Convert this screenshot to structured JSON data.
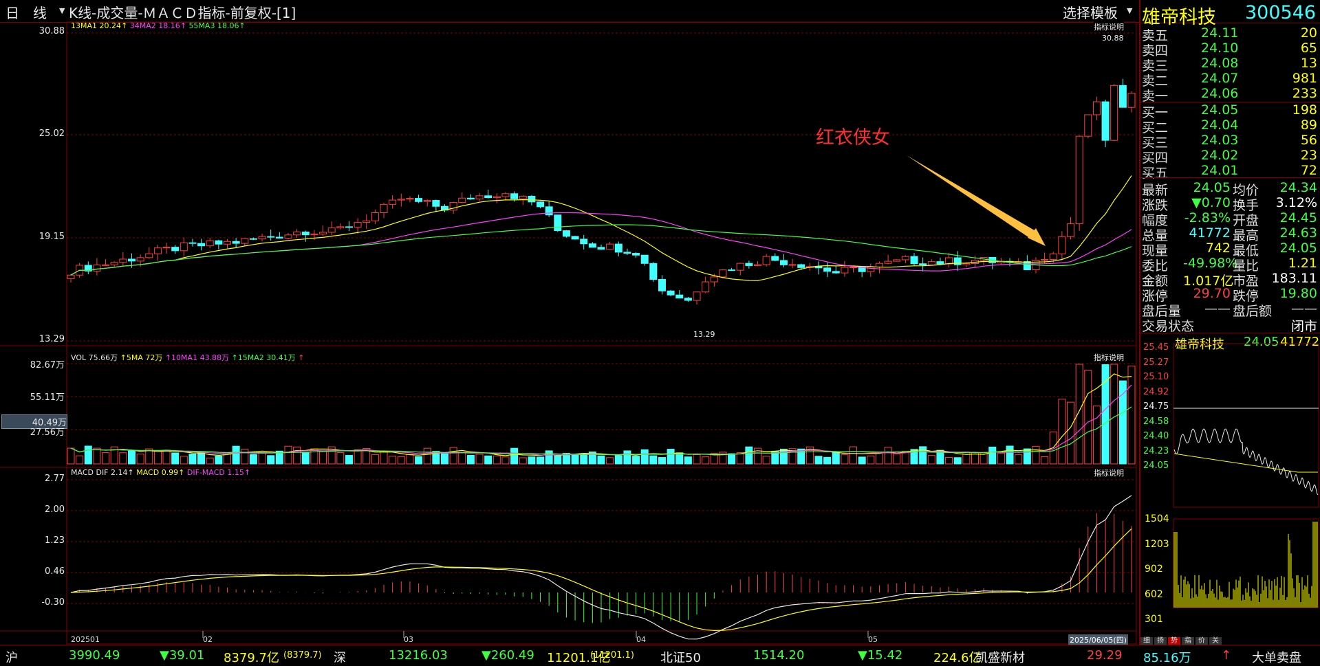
{
  "header": {
    "period": "日　线",
    "title": "K线-成交量-ＭＡＣＤ指标-前复权-[1]",
    "template_btn": "选择模板"
  },
  "stock": {
    "name": "雄帝科技",
    "code": "300546"
  },
  "kline": {
    "ma_legend": [
      {
        "text": "13MA1 20.24↑",
        "color": "#ffff00"
      },
      {
        "text": "34MA2 18.16↑",
        "color": "#ff40ff"
      },
      {
        "text": "55MA3 18.06↑",
        "color": "#40ff40"
      }
    ],
    "ylabels": [
      "30.88",
      "25.02",
      "19.15",
      "13.29"
    ],
    "indicator_btn": "指标说明",
    "high_note": "30.88",
    "low_note": "13.29",
    "annotation": "红衣侠女",
    "up_color": "#ff4040",
    "down_color": "#40ffff"
  },
  "volume": {
    "legend": [
      {
        "text": "VOL 75.66万",
        "color": "#e8e8e8"
      },
      {
        "text": "↑5MA 72万",
        "color": "#ffff00"
      },
      {
        "text": "↑10MA1 43.88万",
        "color": "#ff40ff"
      },
      {
        "text": "↑15MA2 30.41万",
        "color": "#40ff40"
      },
      {
        "text": "↑",
        "color": "#ff4040"
      }
    ],
    "ylabels": [
      "82.67万",
      "55.11万",
      "40.49万",
      "27.56万"
    ],
    "indicator_btn": "指标说明"
  },
  "macd": {
    "legend": [
      {
        "text": "MACD DIF 2.14↑",
        "color": "#e8e8e8"
      },
      {
        "text": "MACD 0.99↑",
        "color": "#ffff00"
      },
      {
        "text": "DIF-MACD 1.15↑",
        "color": "#ff40ff"
      }
    ],
    "ylabels": [
      "2.77",
      "2.00",
      "1.23",
      "0.46",
      "-0.30"
    ],
    "indicator_btn": "指标说明"
  },
  "xaxis": {
    "labels": [
      "202501",
      "02",
      "03",
      "04",
      "05"
    ],
    "current_date": "2025/06/05(四)"
  },
  "orderbook": [
    {
      "label": "卖五",
      "price": "24.11",
      "vol": "20"
    },
    {
      "label": "卖四",
      "price": "24.10",
      "vol": "65"
    },
    {
      "label": "卖三",
      "price": "24.08",
      "vol": "13"
    },
    {
      "label": "卖二",
      "price": "24.07",
      "vol": "981"
    },
    {
      "label": "卖一",
      "price": "24.06",
      "vol": "233"
    },
    {
      "label": "买一",
      "price": "24.05",
      "vol": "198"
    },
    {
      "label": "买二",
      "price": "24.04",
      "vol": "89"
    },
    {
      "label": "买三",
      "price": "24.03",
      "vol": "56"
    },
    {
      "label": "买四",
      "price": "24.02",
      "vol": "23"
    },
    {
      "label": "买五",
      "price": "24.01",
      "vol": "72"
    }
  ],
  "quote": [
    {
      "l1": "最新",
      "v1": "24.05",
      "c1": "#40ff40",
      "l2": "均价",
      "v2": "24.34",
      "c2": "#40ff40"
    },
    {
      "l1": "涨跌",
      "v1": "▼0.70",
      "c1": "#40ff40",
      "l2": "换手",
      "v2": "3.12%",
      "c2": "#ffffff"
    },
    {
      "l1": "幅度",
      "v1": "-2.83%",
      "c1": "#40ff40",
      "l2": "开盘",
      "v2": "24.45",
      "c2": "#40ff40"
    },
    {
      "l1": "总量",
      "v1": "41772",
      "c1": "#40ffff",
      "l2": "最高",
      "v2": "24.63",
      "c2": "#40ff40"
    },
    {
      "l1": "现量",
      "v1": "742",
      "c1": "#ffff00",
      "l2": "最低",
      "v2": "24.05",
      "c2": "#40ff40"
    },
    {
      "l1": "委比",
      "v1": "-49.98%",
      "c1": "#40ff40",
      "l2": "量比",
      "v2": "1.21",
      "c2": "#ffff00"
    },
    {
      "l1": "金额",
      "v1": "1.017亿",
      "c1": "#ffff00",
      "l2": "市盈",
      "v2": "183.11",
      "c2": "#ffffff"
    },
    {
      "l1": "涨停",
      "v1": "29.70",
      "c1": "#ff4040",
      "l2": "跌停",
      "v2": "19.80",
      "c2": "#40ff40"
    },
    {
      "l1": "盘后量",
      "v1": "——",
      "c1": "#c8c8c8",
      "l2": "盘后额",
      "v2": "——",
      "c2": "#c8c8c8"
    },
    {
      "l1": "交易状态",
      "v1": "",
      "c1": "#c8c8c8",
      "l2": "",
      "v2": "闭市",
      "c2": "#ffffff"
    }
  ],
  "minichart": {
    "name": "雄帝科技",
    "price": "24.05",
    "volume": "41772",
    "price_labels": [
      "25.45",
      "25.27",
      "25.10",
      "24.92",
      "24.75",
      "24.58",
      "24.40",
      "24.23",
      "24.05"
    ],
    "vol_labels": [
      "1504",
      "1203",
      "902",
      "602",
      "301"
    ]
  },
  "tabs": [
    "细",
    "扬",
    "势",
    "指",
    "价",
    "关"
  ],
  "footer": [
    {
      "text": "沪",
      "color": "#e8e8e8"
    },
    {
      "text": "3990.49",
      "color": "#40ff40"
    },
    {
      "text": "▼39.01",
      "color": "#40ff40"
    },
    {
      "text": "8379.7亿",
      "color": "#ffff00"
    },
    {
      "text": "(8379.7)",
      "color": "#ffff00"
    },
    {
      "text": "深",
      "color": "#e8e8e8"
    },
    {
      "text": "13216.03",
      "color": "#40ff40"
    },
    {
      "text": "▼260.49",
      "color": "#40ff40"
    },
    {
      "text": "11201.1亿",
      "color": "#ffff00"
    },
    {
      "text": "(11201.1)",
      "color": "#ffff00"
    },
    {
      "text": "北证50",
      "color": "#e8e8e8"
    },
    {
      "text": "1514.20",
      "color": "#40ff40"
    },
    {
      "text": "▼15.42",
      "color": "#40ff40"
    },
    {
      "text": "224.6亿",
      "color": "#ffff00"
    },
    {
      "text": "凯盛新材",
      "color": "#e8e8e8"
    },
    {
      "text": "29.29",
      "color": "#ff4040"
    },
    {
      "text": "85.16万",
      "color": "#40ffff"
    },
    {
      "text": "↑",
      "color": "#ff4040"
    },
    {
      "text": "大单卖盘",
      "color": "#e8e8e8"
    }
  ],
  "colors": {
    "frame": "#800000",
    "ma13": "#ffff00",
    "ma34": "#ff40ff",
    "ma55": "#40ff40",
    "dif": "#e8e8e8",
    "dea": "#ffff00"
  }
}
